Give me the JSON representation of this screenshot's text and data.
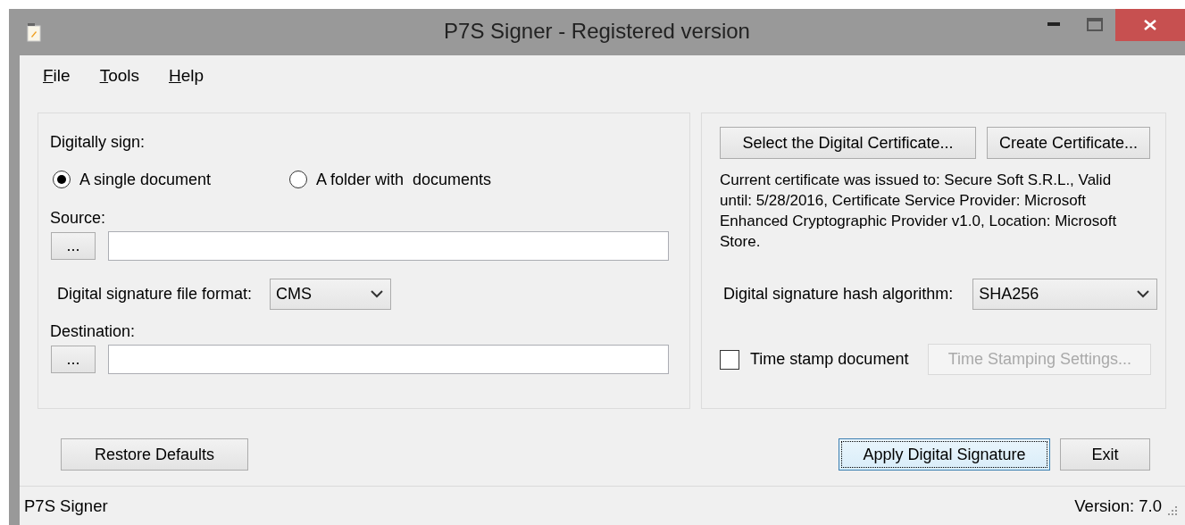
{
  "window": {
    "title": "P7S Signer - Registered version"
  },
  "menu": [
    "File",
    "Tools",
    "Help"
  ],
  "sign_group": {
    "label": "Digitally sign:",
    "options": [
      {
        "label": "A single document",
        "selected": true
      },
      {
        "label": "A folder with  documents",
        "selected": false
      }
    ],
    "source": {
      "label": "Source:",
      "browse": "..."
    },
    "format": {
      "label": "Digital signature file format:",
      "value": "CMS"
    },
    "destination": {
      "label": "Destination:",
      "browse": "..."
    }
  },
  "cert_group": {
    "select_button": "Select the Digital Certificate...",
    "create_button": "Create Certificate...",
    "info": "Current certificate was issued to: Secure Soft S.R.L., Valid until: 5/28/2016, Certificate Service Provider: Microsoft Enhanced Cryptographic Provider v1.0, Location: Microsoft Store.",
    "hash": {
      "label": "Digital signature hash algorithm:",
      "value": "SHA256"
    },
    "timestamp": {
      "label": "Time stamp document",
      "checked": false
    },
    "settings_button": {
      "label": "Time Stamping Settings...",
      "disabled": true
    }
  },
  "buttons": [
    {
      "label": "Restore Defaults",
      "focused": false
    },
    {
      "label": "Apply Digital Signature",
      "focused": true
    },
    {
      "label": "Exit",
      "focused": false
    }
  ],
  "status_bar": {
    "left": "P7S Signer",
    "right": "Version: 7.0"
  }
}
